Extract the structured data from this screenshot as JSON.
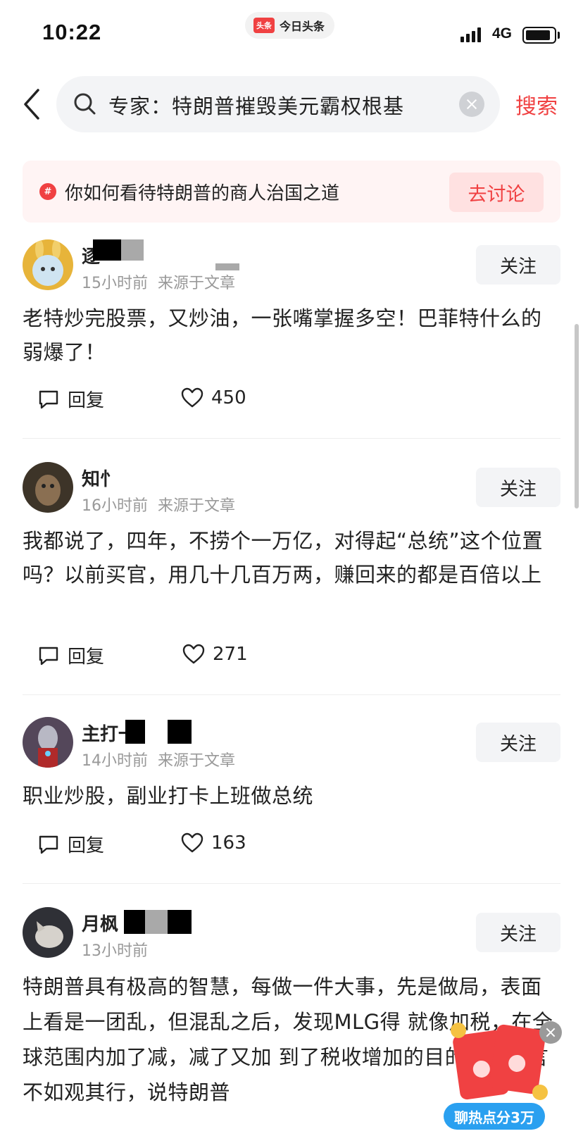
{
  "status_bar": {
    "time": "10:22",
    "app_name": "今日头条",
    "app_logo_text": "头条",
    "network": "4G",
    "battery_level": 0.9
  },
  "search": {
    "query": "专家：特朗普摧毁美元霸权根基",
    "submit_label": "搜索"
  },
  "topic": {
    "icon": "#",
    "text": "你如何看待特朗普的商人治国之道",
    "button_label": "去讨论"
  },
  "comments": [
    {
      "username": "逐",
      "time": "15小时前",
      "source": "来源于文章",
      "follow_label": "关注",
      "text": "老特炒完股票，又炒油，一张嘴掌握多空！巴菲特什么的弱爆了！",
      "reply_label": "回复",
      "likes": "450"
    },
    {
      "username": "知忄",
      "time": "16小时前",
      "source": "来源于文章",
      "follow_label": "关注",
      "text": "我都说了，四年，不捞个一万亿，对得起“总统”这个位置吗？以前买官，用几十几百万两，赚回来的都是百倍以上",
      "reply_label": "回复",
      "likes": "271"
    },
    {
      "username": "主打一",
      "time": "14小时前",
      "source": "来源于文章",
      "follow_label": "关注",
      "text": "职业炒股，副业打卡上班做总统",
      "reply_label": "回复",
      "likes": "163"
    },
    {
      "username": "月枫",
      "time": "13小时前",
      "source": "",
      "follow_label": "关注",
      "text": "特朗普具有极高的智慧，每做一件大事，先是做局，表面上看是一团乱，但混乱之后，发现MLG得 就像加税，在全球范围内加了减，减了又加 到了税收增加的目的。听其言不如观其行，说特朗普"
    }
  ],
  "promo": {
    "label": "聊热点分3万"
  },
  "colors": {
    "accent": "#f04142",
    "promo_blue": "#2aa0f0"
  },
  "icons": [
    "back-arrow-icon",
    "search-icon",
    "clear-icon",
    "hashtag-icon",
    "reply-icon",
    "heart-icon",
    "close-icon",
    "red-envelope-icon"
  ]
}
